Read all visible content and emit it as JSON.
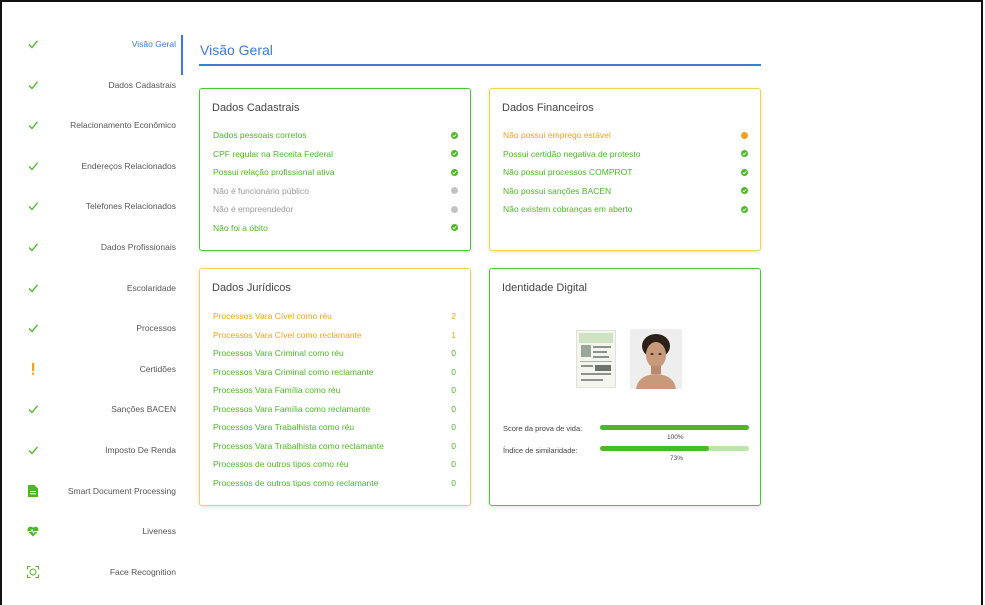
{
  "sidebar": {
    "items": [
      {
        "label": "Visão Geral",
        "status": "check",
        "active": true
      },
      {
        "label": "Dados Cadastrais",
        "status": "check"
      },
      {
        "label": "Relacionamento Econômico",
        "status": "check"
      },
      {
        "label": "Endereços Relacionados",
        "status": "check"
      },
      {
        "label": "Telefones Relacionados",
        "status": "check"
      },
      {
        "label": "Dados Profissionais",
        "status": "check"
      },
      {
        "label": "Escolaridade",
        "status": "check"
      },
      {
        "label": "Processos",
        "status": "check"
      },
      {
        "label": "Certidões",
        "status": "warning"
      },
      {
        "label": "Sanções BACEN",
        "status": "check"
      },
      {
        "label": "Imposto De Renda",
        "status": "check"
      },
      {
        "label": "Smart Document Processing",
        "status": "document-icon"
      },
      {
        "label": "Liveness",
        "status": "heart-pulse-icon"
      },
      {
        "label": "Face Recognition",
        "status": "face-scan-icon"
      }
    ]
  },
  "page": {
    "title": "Visão Geral"
  },
  "cards": {
    "cadastrais": {
      "title": "Dados Cadastrais",
      "rows": [
        {
          "text": "Dados pessoais corretos",
          "state": "ok"
        },
        {
          "text": "CPF regular na Receita Federal",
          "state": "ok"
        },
        {
          "text": "Possui relação profissional ativa",
          "state": "ok"
        },
        {
          "text": "Não é funcionário público",
          "state": "off"
        },
        {
          "text": "Não é empreendedor",
          "state": "off"
        },
        {
          "text": "Não foi a óbito",
          "state": "ok"
        }
      ]
    },
    "financeiros": {
      "title": "Dados Financeiros",
      "rows": [
        {
          "text": "Não possui emprego estável",
          "state": "warn"
        },
        {
          "text": "Possui certidão negativa de protesto",
          "state": "ok"
        },
        {
          "text": "Não possui processos COMPROT",
          "state": "ok"
        },
        {
          "text": "Não possui sanções BACEN",
          "state": "ok"
        },
        {
          "text": "Não existem cobranças em aberto",
          "state": "ok"
        }
      ]
    },
    "juridicos": {
      "title": "Dados Jurídicos",
      "rows": [
        {
          "text": "Processos Vara Cível como réu",
          "value": "2",
          "state": "warn"
        },
        {
          "text": "Processos Vara Cível como reclamante",
          "value": "1",
          "state": "warn"
        },
        {
          "text": "Processos Vara Criminal como réu",
          "value": "0",
          "state": "ok"
        },
        {
          "text": "Processos Vara Criminal como reclamante",
          "value": "0",
          "state": "ok"
        },
        {
          "text": "Processos Vara Família como réu",
          "value": "0",
          "state": "ok"
        },
        {
          "text": "Processos Vara Família como reclamante",
          "value": "0",
          "state": "ok"
        },
        {
          "text": "Processos Vara Trabalhista como réu",
          "value": "0",
          "state": "ok"
        },
        {
          "text": "Processos Vara Trabalhista como reclamante",
          "value": "0",
          "state": "ok"
        },
        {
          "text": "Processos de outros tipos como réu",
          "value": "0",
          "state": "ok"
        },
        {
          "text": "Processos de outros tipos como reclamante",
          "value": "0",
          "state": "ok"
        }
      ]
    },
    "identidade": {
      "title": "Identidade Digital",
      "score_label": "Score da prova de vida:",
      "score_value": "100%",
      "score_fraction": 1.0,
      "similarity_label": "Índice de similaridade:",
      "similarity_value": "73%",
      "similarity_fraction": 0.73
    }
  },
  "colors": {
    "accent": "#3a7bd5",
    "ok": "#4cb826",
    "warn": "#f2a21d",
    "off": "#c3c3c3"
  }
}
